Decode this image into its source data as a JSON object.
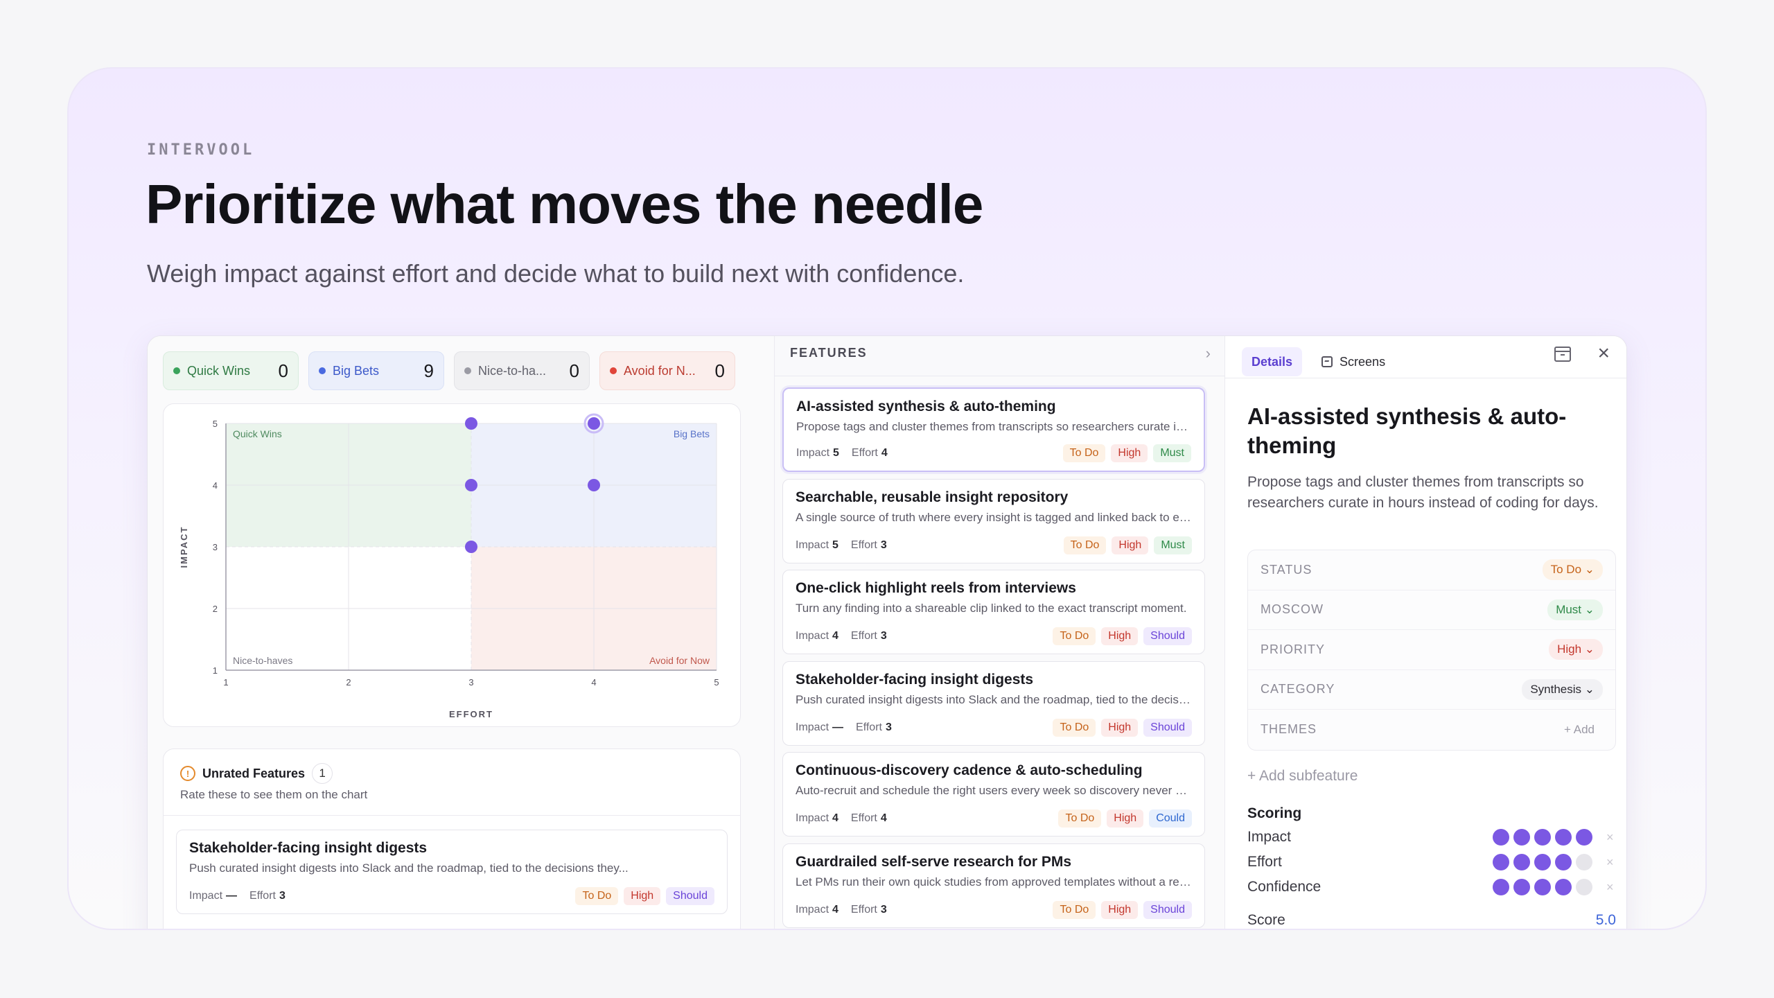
{
  "brand": "INTERVOOL",
  "headline": "Prioritize what moves the needle",
  "subline": "Weigh impact against effort and decide what to build next with confidence.",
  "quadrants": [
    {
      "label": "Quick Wins",
      "count": "0"
    },
    {
      "label": "Big Bets",
      "count": "9"
    },
    {
      "label": "Nice-to-ha...",
      "count": "0"
    },
    {
      "label": "Avoid for N...",
      "count": "0"
    }
  ],
  "chart_data": {
    "type": "scatter",
    "xlabel": "EFFORT",
    "ylabel": "IMPACT",
    "xlim": [
      1,
      5
    ],
    "ylim": [
      1,
      5
    ],
    "x_ticks": [
      "1",
      "2",
      "3",
      "4",
      "5"
    ],
    "y_ticks": [
      "1",
      "2",
      "3",
      "4",
      "5"
    ],
    "quadrant_labels": {
      "top_left": "Quick Wins",
      "top_right": "Big Bets",
      "bottom_left": "Nice-to-haves",
      "bottom_right": "Avoid for Now"
    },
    "points": [
      {
        "x": 3,
        "y": 5
      },
      {
        "x": 4,
        "y": 5,
        "highlighted": true
      },
      {
        "x": 3,
        "y": 4
      },
      {
        "x": 4,
        "y": 4
      },
      {
        "x": 3,
        "y": 3
      }
    ],
    "colors": {
      "point": "#7b58e3",
      "quick_wins": "#eaf4ec",
      "big_bets": "#edf0fb",
      "avoid": "#fbeeec"
    }
  },
  "unrated": {
    "title": "Unrated Features",
    "count": "1",
    "subtitle": "Rate these to see them on the chart",
    "card": {
      "title": "Stakeholder-facing insight digests",
      "desc": "Push curated insight digests into Slack and the roadmap, tied to the decisions they...",
      "impact_label": "Impact",
      "impact": "—",
      "effort_label": "Effort",
      "effort": "3",
      "status": "To Do",
      "priority": "High",
      "moscow": "Should"
    }
  },
  "features": {
    "header": "FEATURES",
    "items": [
      {
        "title": "AI-assisted synthesis & auto-theming",
        "desc": "Propose tags and cluster themes from transcripts so researchers curate in hours instead of coding for days.",
        "impact_label": "Impact",
        "impact": "5",
        "effort_label": "Effort",
        "effort": "4",
        "status": "To Do",
        "priority": "High",
        "moscow": "Must"
      },
      {
        "title": "Searchable, reusable insight repository",
        "desc": "A single source of truth where every insight is tagged and linked back to evidence.",
        "impact_label": "Impact",
        "impact": "5",
        "effort_label": "Effort",
        "effort": "3",
        "status": "To Do",
        "priority": "High",
        "moscow": "Must"
      },
      {
        "title": "One-click highlight reels from interviews",
        "desc": "Turn any finding into a shareable clip linked to the exact transcript moment.",
        "impact_label": "Impact",
        "impact": "4",
        "effort_label": "Effort",
        "effort": "3",
        "status": "To Do",
        "priority": "High",
        "moscow": "Should"
      },
      {
        "title": "Stakeholder-facing insight digests",
        "desc": "Push curated insight digests into Slack and the roadmap, tied to the decisions they inform.",
        "impact_label": "Impact",
        "impact": "—",
        "effort_label": "Effort",
        "effort": "3",
        "status": "To Do",
        "priority": "High",
        "moscow": "Should"
      },
      {
        "title": "Continuous-discovery cadence & auto-scheduling",
        "desc": "Auto-recruit and schedule the right users every week so discovery never stalls.",
        "impact_label": "Impact",
        "impact": "4",
        "effort_label": "Effort",
        "effort": "4",
        "status": "To Do",
        "priority": "High",
        "moscow": "Could"
      },
      {
        "title": "Guardrailed self-serve research for PMs",
        "desc": "Let PMs run their own quick studies from approved templates without a researcher.",
        "impact_label": "Impact",
        "impact": "4",
        "effort_label": "Effort",
        "effort": "3",
        "status": "To Do",
        "priority": "High",
        "moscow": "Should"
      }
    ]
  },
  "details": {
    "tab_details": "Details",
    "tab_screens": "Screens",
    "title": "AI-assisted synthesis & auto-theming",
    "desc": "Propose tags and cluster themes from transcripts so researchers curate in hours instead of coding for days.",
    "props": [
      {
        "label": "STATUS",
        "value": "To Do ⌄"
      },
      {
        "label": "MOSCOW",
        "value": "Must ⌄"
      },
      {
        "label": "PRIORITY",
        "value": "High ⌄"
      },
      {
        "label": "CATEGORY",
        "value": "Synthesis ⌄"
      },
      {
        "label": "THEMES",
        "value": "+ Add"
      }
    ],
    "add_subfeature": "+ Add subfeature",
    "scoring_title": "Scoring",
    "scores": [
      {
        "label": "Impact",
        "value": 5,
        "max": 5
      },
      {
        "label": "Effort",
        "value": 4,
        "max": 5
      },
      {
        "label": "Confidence",
        "value": 4,
        "max": 5
      }
    ],
    "score_label": "Score",
    "score_value": "5.0"
  }
}
